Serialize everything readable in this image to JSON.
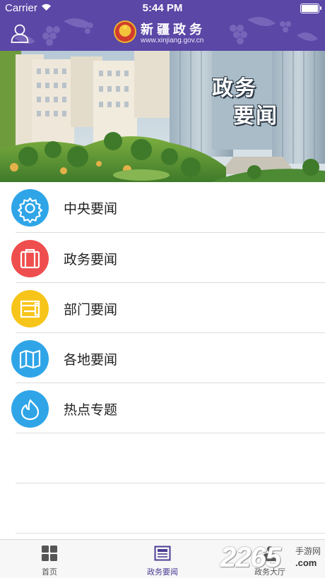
{
  "status_bar": {
    "carrier": "Carrier",
    "time": "5:44 PM"
  },
  "header": {
    "title": "新疆政务",
    "url": "www.xinjiang.gov.cn",
    "background_color": "#5a47a6",
    "user_icon": "user-icon",
    "emblem": "national-emblem"
  },
  "banner": {
    "title_line1": "政务",
    "title_line2": "要闻"
  },
  "menu": {
    "items": [
      {
        "label": "中央要闻",
        "icon": "gear-icon",
        "color": "#2fa5e8"
      },
      {
        "label": "政务要闻",
        "icon": "briefcase-icon",
        "color": "#ef4e4e"
      },
      {
        "label": "部门要闻",
        "icon": "folder-icon",
        "color": "#f7c51a"
      },
      {
        "label": "各地要闻",
        "icon": "map-icon",
        "color": "#2fa5e8"
      },
      {
        "label": "热点专题",
        "icon": "flame-icon",
        "color": "#2fa5e8"
      }
    ]
  },
  "tabbar": {
    "tabs": [
      {
        "label": "首页",
        "icon": "grid-icon",
        "active": false
      },
      {
        "label": "政务要闻",
        "icon": "news-icon",
        "active": true
      },
      {
        "label": "政务大厅",
        "icon": "hall-icon",
        "active": false
      }
    ],
    "active_color": "#4a3c93"
  },
  "watermark": {
    "number": "2265",
    "site": "手游网",
    "domain": ".com"
  }
}
